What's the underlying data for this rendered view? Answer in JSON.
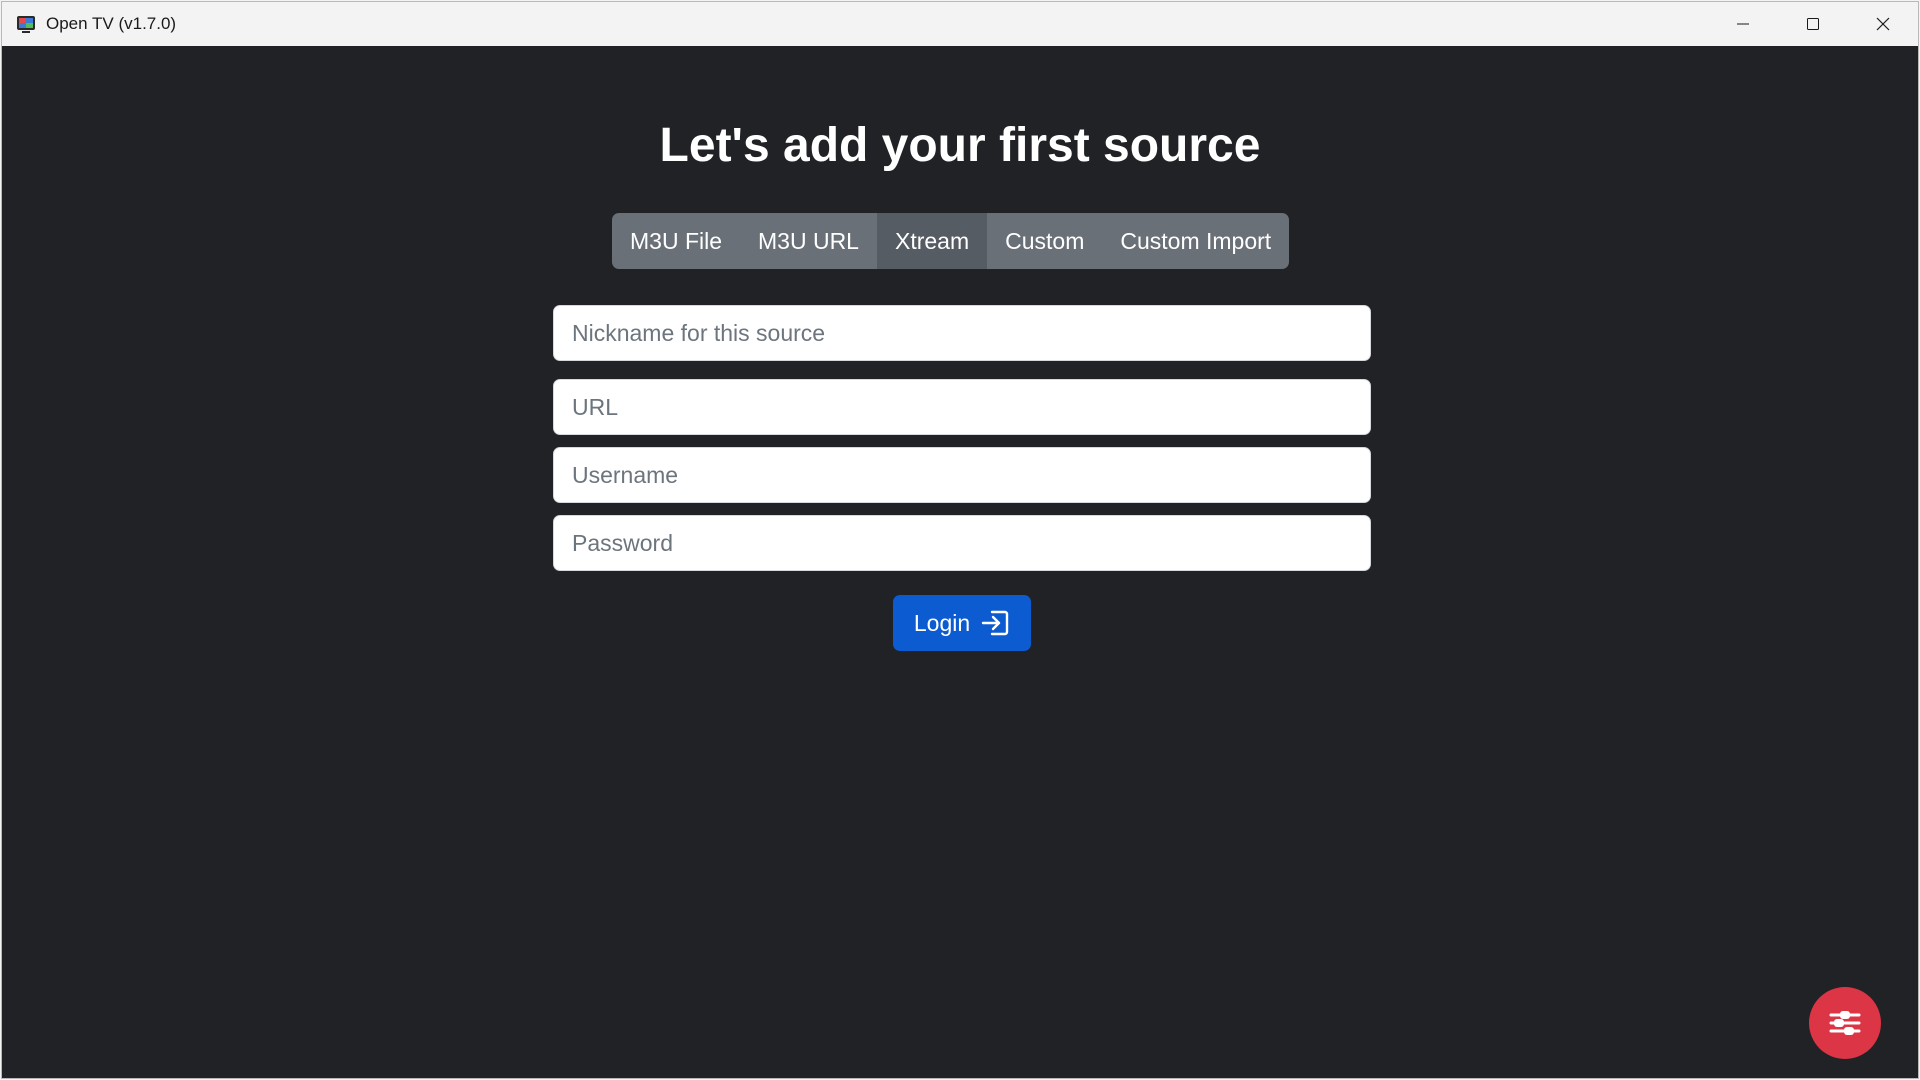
{
  "window": {
    "title": "Open TV (v1.7.0)",
    "icon": "tv-app-icon"
  },
  "window_controls": {
    "minimize_icon": "minimize-icon",
    "maximize_icon": "maximize-icon",
    "close_icon": "close-icon"
  },
  "main": {
    "heading": "Let's add your first source",
    "tabs": [
      {
        "label": "M3U File",
        "active": false
      },
      {
        "label": "M3U URL",
        "active": false
      },
      {
        "label": "Xtream",
        "active": true
      },
      {
        "label": "Custom",
        "active": false
      },
      {
        "label": "Custom Import",
        "active": false
      }
    ],
    "form": {
      "nickname_placeholder": "Nickname for this source",
      "url_placeholder": "URL",
      "username_placeholder": "Username",
      "password_placeholder": "Password",
      "nickname_value": "",
      "url_value": "",
      "username_value": "",
      "password_value": ""
    },
    "login_button": {
      "label": "Login",
      "icon": "login-arrow-icon"
    }
  },
  "fab": {
    "icon": "settings-sliders-icon"
  },
  "colors": {
    "background": "#212225",
    "tab_group": "#6a7077",
    "tab_active": "#565c63",
    "primary": "#0d5bd0",
    "fab": "#dc3545"
  }
}
